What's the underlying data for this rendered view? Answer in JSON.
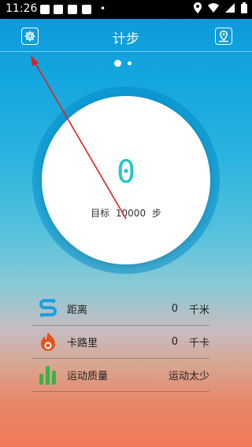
{
  "status": {
    "time": "11:26",
    "dot": "•"
  },
  "header": {
    "title": "计步",
    "settings_icon": "gear-icon",
    "location_icon": "location-icon"
  },
  "pager": {
    "pages": 2,
    "active": 1
  },
  "progress": {
    "steps": "0",
    "goal_label": "目标",
    "goal_value": "10000",
    "goal_unit": "步"
  },
  "stats": [
    {
      "label": "距离",
      "value": "0",
      "unit": "千米",
      "icon": "distance-icon",
      "color": "#1e9fe0"
    },
    {
      "label": "卡路里",
      "value": "0",
      "unit": "千卡",
      "icon": "flame-icon",
      "color": "#e2541d"
    },
    {
      "label": "运动质量",
      "value": "",
      "unit": "运动太少",
      "icon": "bars-icon",
      "color": "#38b24a"
    }
  ],
  "colors": {
    "accent_steps": "#25c6c6",
    "arrow": "#e0221f"
  }
}
